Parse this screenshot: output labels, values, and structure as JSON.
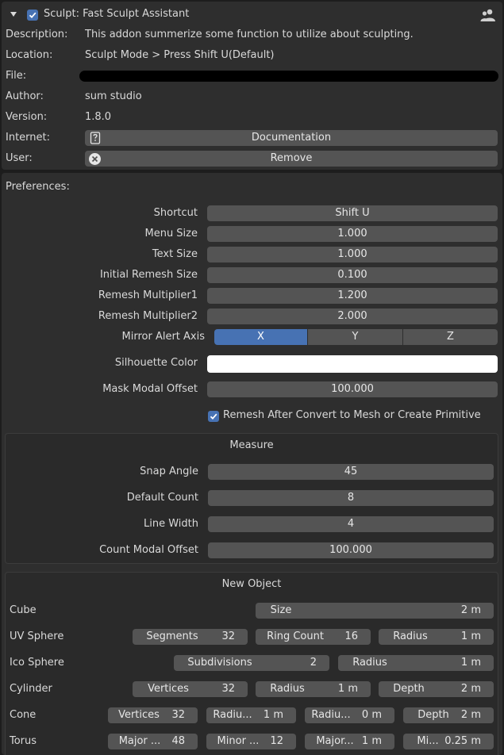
{
  "header": {
    "title": "Sculpt: Fast Sculpt Assistant",
    "enabled": true
  },
  "info": {
    "description_label": "Description:",
    "description_value": "This addon summerize some function to utilize about sculpting.",
    "location_label": "Location:",
    "location_value": "Sculpt Mode > Press Shift U(Default)",
    "file_label": "File:",
    "author_label": "Author:",
    "author_value": "sum studio",
    "version_label": "Version:",
    "version_value": "1.8.0",
    "internet_label": "Internet:",
    "documentation_button": "Documentation",
    "user_label": "User:",
    "remove_button": "Remove"
  },
  "preferences": {
    "title": "Preferences:",
    "shortcut_label": "Shortcut",
    "shortcut_value": "Shift U",
    "menu_size_label": "Menu Size",
    "menu_size_value": "1.000",
    "text_size_label": "Text Size",
    "text_size_value": "1.000",
    "initial_remesh_label": "Initial Remesh Size",
    "initial_remesh_value": "0.100",
    "remesh_mult1_label": "Remesh Multiplier1",
    "remesh_mult1_value": "1.200",
    "remesh_mult2_label": "Remesh Multiplier2",
    "remesh_mult2_value": "2.000",
    "mirror_axis_label": "Mirror Alert Axis",
    "axis_x": "X",
    "axis_y": "Y",
    "axis_z": "Z",
    "axis_selected": "X",
    "silhouette_label": "Silhouette Color",
    "silhouette_color": "#ffffff",
    "mask_offset_label": "Mask Modal Offset",
    "mask_offset_value": "100.000",
    "remesh_after_label": "Remesh After Convert to Mesh or Create Primitive",
    "remesh_after_checked": true
  },
  "measure": {
    "title": "Measure",
    "snap_angle_label": "Snap Angle",
    "snap_angle_value": "45",
    "default_count_label": "Default Count",
    "default_count_value": "8",
    "line_width_label": "Line Width",
    "line_width_value": "4",
    "count_offset_label": "Count Modal Offset",
    "count_offset_value": "100.000"
  },
  "new_object": {
    "title": "New Object",
    "cube": {
      "label": "Cube",
      "size_key": "Size",
      "size_val": "2 m"
    },
    "uv_sphere": {
      "label": "UV Sphere",
      "seg_key": "Segments",
      "seg_val": "32",
      "ring_key": "Ring Count",
      "ring_val": "16",
      "rad_key": "Radius",
      "rad_val": "1 m"
    },
    "ico_sphere": {
      "label": "Ico Sphere",
      "sub_key": "Subdivisions",
      "sub_val": "2",
      "rad_key": "Radius",
      "rad_val": "1 m"
    },
    "cylinder": {
      "label": "Cylinder",
      "vert_key": "Vertices",
      "vert_val": "32",
      "rad_key": "Radius",
      "rad_val": "1 m",
      "depth_key": "Depth",
      "depth_val": "2 m"
    },
    "cone": {
      "label": "Cone",
      "vert_key": "Vertices",
      "vert_val": "32",
      "r1_key": "Radiu...",
      "r1_val": "1 m",
      "r2_key": "Radiu...",
      "r2_val": "0 m",
      "depth_key": "Depth",
      "depth_val": "2 m"
    },
    "torus": {
      "label": "Torus",
      "maj_key": "Major ...",
      "maj_val": "48",
      "min_key": "Minor ...",
      "min_val": "12",
      "majr_key": "Major...",
      "majr_val": "1 m",
      "minr_key": "Mi...",
      "minr_val": "0.25 m"
    }
  },
  "colors": {
    "accent": "#4772b3",
    "field": "#545454",
    "panel": "#2e2e2e",
    "background": "#1d1d1d"
  }
}
